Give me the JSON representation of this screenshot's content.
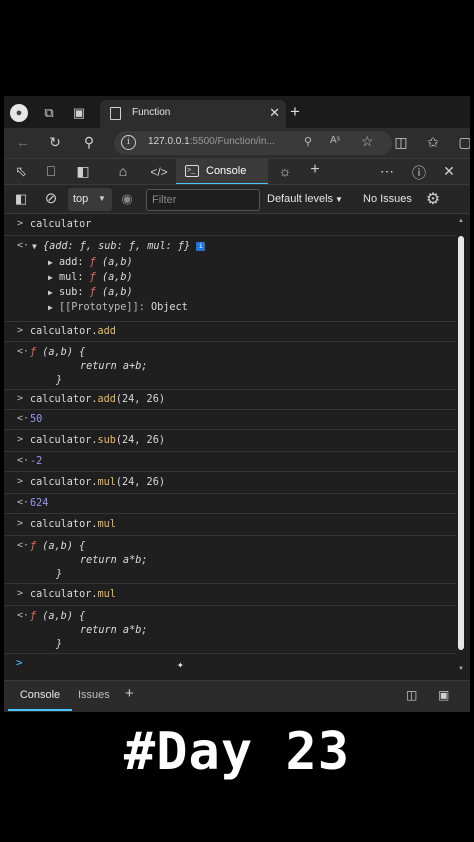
{
  "browser": {
    "tab_title": "Function",
    "url_host": "127.0.0.1",
    "url_rest": ":5500/Function/in...",
    "reader_label": "Aˢ",
    "icons": [
      "profile-icon",
      "workspaces-icon",
      "tab-actions-icon",
      "page-icon",
      "close-icon",
      "plus-icon",
      "back-icon",
      "refresh-icon",
      "search-icon",
      "info-icon",
      "zoom-icon",
      "read-aloud-icon",
      "favorite-icon",
      "split-screen-icon",
      "favorites-icon",
      "collections-icon"
    ]
  },
  "devtools": {
    "console_tab": "Console",
    "icons": [
      "inspect-icon",
      "device-icon",
      "dock-icon",
      "welcome-icon",
      "sources-icon",
      "console-icon",
      "debug-icon",
      "plus-icon",
      "more-icon",
      "help-icon",
      "close-icon"
    ]
  },
  "filterbar": {
    "context": "top",
    "filter_placeholder": "Filter",
    "levels": "Default levels",
    "issues": "No Issues"
  },
  "console": {
    "c1": "calculator",
    "r1_head": "{add: ƒ, sub: ƒ, mul: ƒ}",
    "r1_props": [
      {
        "key": "add",
        "val": "(a,b)"
      },
      {
        "key": "mul",
        "val": "(a,b)"
      },
      {
        "key": "sub",
        "val": "(a,b)"
      }
    ],
    "r1_proto_key": "[[Prototype]]",
    "r1_proto_val": "Object",
    "obj": "calculator",
    "m_add": "add",
    "m_sub": "sub",
    "m_mul": "mul",
    "args": "(24, 26)",
    "f_sig": "(a,b) {",
    "ret_add": "return a+b;",
    "ret_mul": "return a*b;",
    "close_brace": "}",
    "res_add": "50",
    "res_sub": "-2",
    "res_mul": "624",
    "badge": "i"
  },
  "drawer": {
    "console_tab": "Console",
    "issues_tab": "Issues"
  },
  "caption": "#Day 23",
  "colors": {
    "accent": "#4cc2ff",
    "property": "#e8b964",
    "function_keyword": "#e66c5c",
    "number": "#9c95f5"
  }
}
